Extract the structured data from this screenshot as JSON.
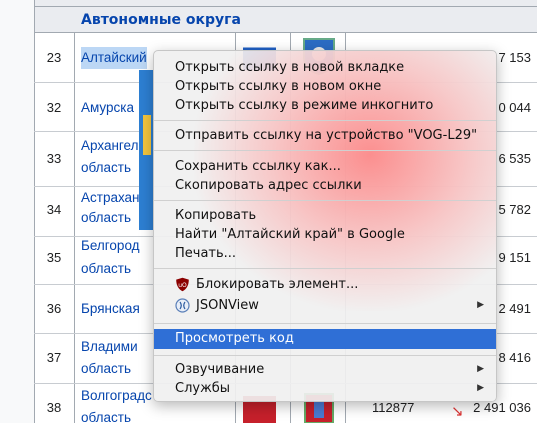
{
  "table": {
    "group_header": "Автономные округа",
    "rows": [
      {
        "num": "23",
        "name": [
          "Алтайский"
        ],
        "pop": "7 153"
      },
      {
        "num": "32",
        "name": [
          "Амурска"
        ],
        "pop": "0 044"
      },
      {
        "num": "33",
        "name": [
          "Архангел",
          "область"
        ],
        "pop": "6 535"
      },
      {
        "num": "34",
        "name": [
          "Астрахан",
          "область"
        ],
        "pop": "5 782"
      },
      {
        "num": "35",
        "name": [
          "Белгород",
          "область"
        ],
        "pop": "9 151"
      },
      {
        "num": "36",
        "name": [
          "Брянская"
        ],
        "pop": "2 491"
      },
      {
        "num": "37",
        "name": [
          "Владими",
          "область"
        ],
        "pop": "8 416"
      },
      {
        "num": "38",
        "name": [
          "Волгоградс",
          "область"
        ],
        "area": "112877",
        "pop": "2 491 036"
      }
    ]
  },
  "menu": {
    "items": [
      {
        "label": "Открыть ссылку в новой вкладке"
      },
      {
        "label": "Открыть ссылку в новом окне"
      },
      {
        "label": "Открыть ссылку в режиме инкогнито"
      },
      {
        "label": "Отправить ссылку на устройство \"VOG-L29\""
      },
      {
        "label": "Сохранить ссылку как..."
      },
      {
        "label": "Скопировать адрес ссылки"
      },
      {
        "label": "Копировать"
      },
      {
        "label": "Найти \"Алтайский край\" в Google"
      },
      {
        "label": "Печать..."
      },
      {
        "label": "Блокировать элемент...",
        "icon": "ublock-icon"
      },
      {
        "label": "JSONView",
        "icon": "jsonview-icon",
        "submenu": true
      },
      {
        "label": "Просмотреть код",
        "selected": true
      },
      {
        "label": "Озвучивание",
        "submenu": true
      },
      {
        "label": "Службы",
        "submenu": true
      }
    ],
    "submenu_arrow": "▶",
    "selection_color": "#2f6fd6"
  }
}
